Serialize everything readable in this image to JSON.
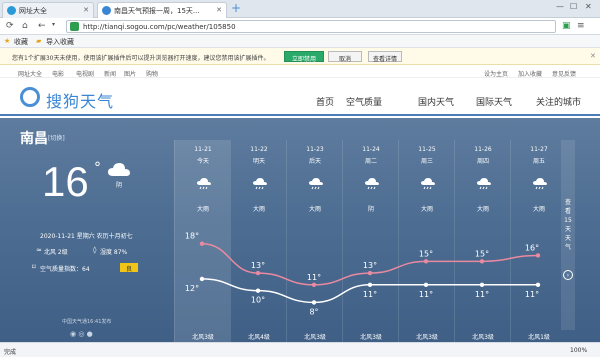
{
  "browser": {
    "tabs": [
      {
        "label": "网址大全"
      },
      {
        "label": "南昌天气预报一周，15天..."
      }
    ],
    "url": "http://tianqi.sogou.com/pc/weather/105850",
    "bookmarks": [
      "收藏",
      "导入收藏"
    ],
    "infobar": {
      "text": "您有1个扩展30天未使用，使用该扩展插件后可以提升浏览器打开速度，建议您禁用该扩展插件。",
      "buttons": [
        "立即禁用",
        "取消",
        "查看详情"
      ]
    },
    "status": {
      "left": "完成",
      "zoom": "100%"
    }
  },
  "site": {
    "toplinks_left": [
      "网址大全",
      "电影",
      "电视剧",
      "新闻",
      "图片",
      "购物"
    ],
    "toplinks_right": [
      "设为主页",
      "加入收藏",
      "意见反馈"
    ],
    "logo": "搜狗天气",
    "nav": [
      "首页",
      "空气质量",
      "国内天气",
      "国际天气",
      "关注的城市"
    ]
  },
  "current": {
    "city": "南昌",
    "switch": "[切换]",
    "temp": "16",
    "deg": "°",
    "weather": "阴",
    "date": "2020-11-21 星期六 农历十月初七",
    "wind": "北风 2级",
    "humidity": "湿度 87%",
    "aqi_label": "空气质量指数：64",
    "aqi_level": "良",
    "source": "中国天气通16:41发布"
  },
  "forecast": [
    {
      "date": "11-21",
      "day": "今天",
      "weather": "大雨",
      "wind": "北风3级"
    },
    {
      "date": "11-22",
      "day": "明天",
      "weather": "大雨",
      "wind": "北风4级"
    },
    {
      "date": "11-23",
      "day": "后天",
      "weather": "大雨",
      "wind": "北风3级"
    },
    {
      "date": "11-24",
      "day": "周二",
      "weather": "阴",
      "wind": "北风3级"
    },
    {
      "date": "11-25",
      "day": "周三",
      "weather": "大雨",
      "wind": "北风3级"
    },
    {
      "date": "11-26",
      "day": "周四",
      "weather": "大雨",
      "wind": "北风3级"
    },
    {
      "date": "11-27",
      "day": "周五",
      "weather": "大雨",
      "wind": "北风1级"
    }
  ],
  "chart_data": {
    "type": "line",
    "categories": [
      "11-21",
      "11-22",
      "11-23",
      "11-24",
      "11-25",
      "11-26",
      "11-27"
    ],
    "series": [
      {
        "values": [
          18,
          13,
          11,
          13,
          15,
          15,
          16
        ],
        "color": "#e98aa0"
      },
      {
        "values": [
          12,
          10,
          8,
          11,
          11,
          11,
          11
        ],
        "color": "#ffffff"
      }
    ],
    "ylim": [
      5,
      20
    ]
  },
  "side": {
    "label": "查看15天天气"
  },
  "colors": {
    "accent": "#3a86d4",
    "aqi": "#f0c419"
  }
}
